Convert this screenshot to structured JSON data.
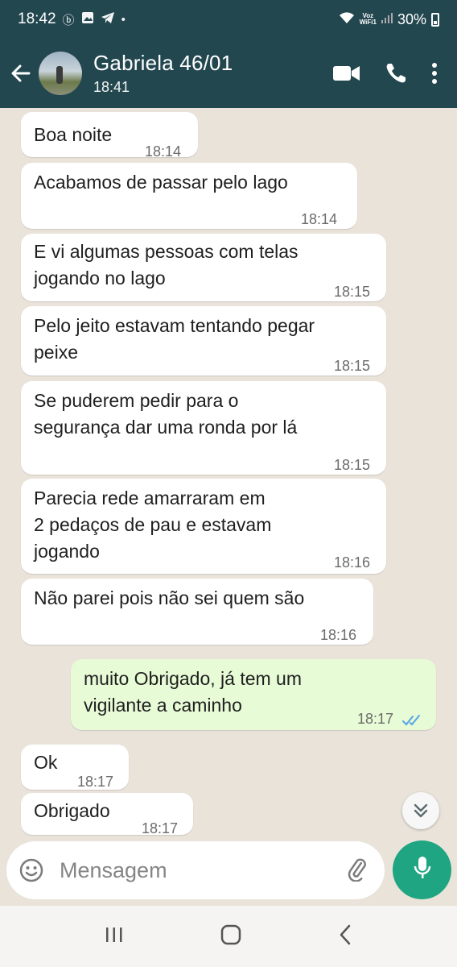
{
  "status_bar": {
    "time": "18:42",
    "battery": "30%",
    "voz_top": "Voz",
    "voz_bottom": "WiFi1"
  },
  "header": {
    "name": "Gabriela 46/01",
    "status": "18:41"
  },
  "messages": [
    {
      "text_lines": [
        "Boa noite"
      ],
      "time": "18:14",
      "direction": "in"
    },
    {
      "text_lines": [
        "Acabamos de passar pelo lago"
      ],
      "time": "18:14",
      "direction": "in"
    },
    {
      "text_lines": [
        "E vi algumas pessoas com telas",
        "jogando no lago"
      ],
      "time": "18:15",
      "direction": "in"
    },
    {
      "text_lines": [
        "Pelo jeito estavam tentando pegar",
        "peixe"
      ],
      "time": "18:15",
      "direction": "in"
    },
    {
      "text_lines": [
        "Se puderem pedir para o",
        "segurança dar uma ronda por lá"
      ],
      "time": "18:15",
      "direction": "in"
    },
    {
      "text_lines": [
        "Parecia rede amarraram em",
        "2 pedaços de pau e estavam",
        "jogando"
      ],
      "time": "18:16",
      "direction": "in"
    },
    {
      "text_lines": [
        "Não parei pois não sei quem são"
      ],
      "time": "18:16",
      "direction": "in"
    },
    {
      "text_lines": [
        "muito Obrigado, já tem um",
        "vigilante a caminho"
      ],
      "time": "18:17",
      "direction": "out",
      "read": true
    },
    {
      "text_lines": [
        "Ok"
      ],
      "time": "18:17",
      "direction": "in"
    },
    {
      "text_lines": [
        "Obrigado"
      ],
      "time": "18:17",
      "direction": "in"
    }
  ],
  "input": {
    "placeholder": "Mensagem"
  },
  "colors": {
    "header": "#23474f",
    "outgoing_bubble": "#e7fbd6",
    "incoming_bubble": "#ffffff",
    "chat_background": "#e9e3da",
    "mic_button": "#1fa581",
    "read_ticks": "#53a6e8"
  },
  "icons": {
    "back": "arrow-left-icon",
    "video": "video-call-icon",
    "call": "phone-icon",
    "menu": "more-vertical-icon",
    "emoji": "emoji-icon",
    "attach": "paperclip-icon",
    "camera": "camera-icon",
    "mic": "mic-icon",
    "scroll": "double-chevron-down-icon"
  }
}
